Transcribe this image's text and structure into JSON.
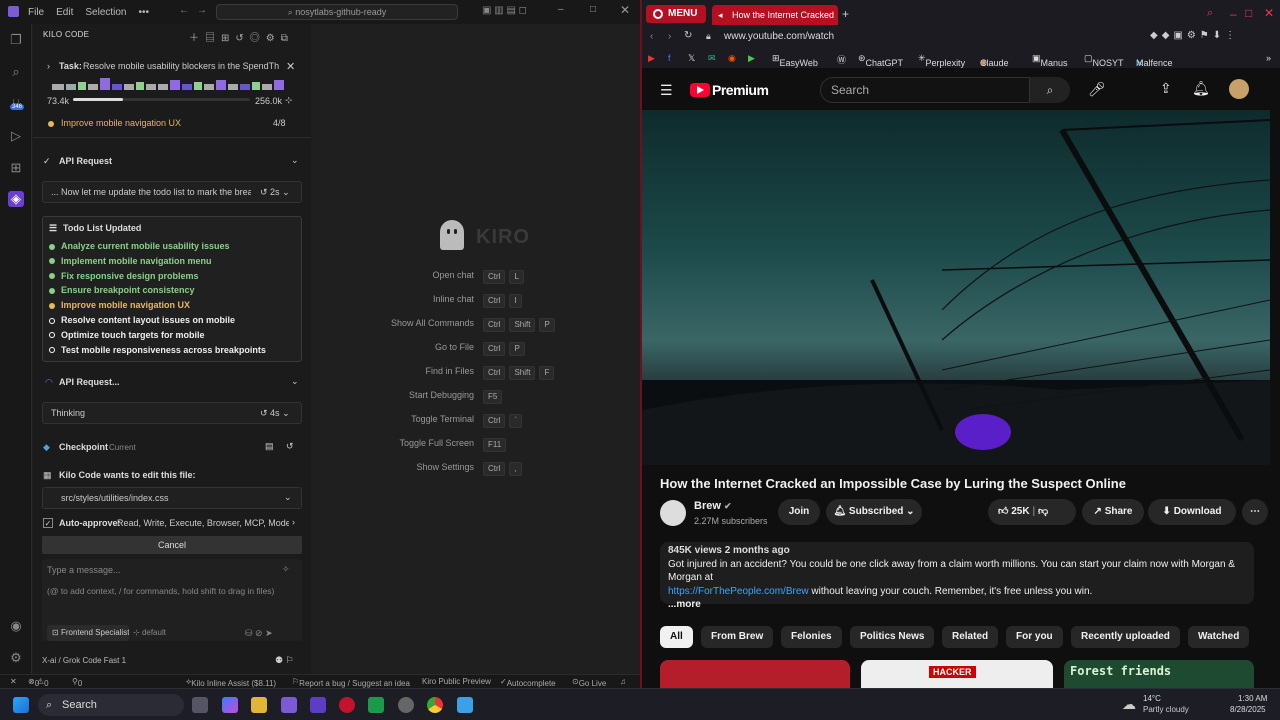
{
  "ide": {
    "menu": [
      "File",
      "Edit",
      "Selection"
    ],
    "search_text": "nosytlabs-github-ready",
    "activity_badge": "346",
    "panel_title": "KILO CODE",
    "task": {
      "prefix": "Task:",
      "text": "Resolve mobile usability blockers in the SpendTh...",
      "tokens_in": "73.4k",
      "tokens_max": "256.0k",
      "context_progress": 0.28
    },
    "current_todo": {
      "label": "Improve mobile navigation UX",
      "count": "4/8"
    },
    "api_request": {
      "label": "API Request",
      "detail": "... Now let me update the todo list to mark the brea...",
      "time": "2s"
    },
    "todo_list": {
      "title": "Todo List Updated",
      "items": [
        {
          "label": "Analyze current mobile usability issues",
          "state": "done",
          "color": "#89d185"
        },
        {
          "label": "Implement mobile navigation menu",
          "state": "done",
          "color": "#89d185"
        },
        {
          "label": "Fix responsive design problems",
          "state": "done",
          "color": "#89d185"
        },
        {
          "label": "Ensure breakpoint consistency",
          "state": "done",
          "color": "#89d185"
        },
        {
          "label": "Improve mobile navigation UX",
          "state": "in-progress",
          "color": "#e8b85a"
        },
        {
          "label": "Resolve content layout issues on mobile",
          "state": "pending",
          "color": "#ffffff"
        },
        {
          "label": "Optimize touch targets for mobile",
          "state": "pending",
          "color": "#ffffff"
        },
        {
          "label": "Test mobile responsiveness across breakpoints",
          "state": "pending",
          "color": "#ffffff"
        }
      ]
    },
    "api_request2": {
      "label": "API Request...",
      "detail": "Thinking",
      "time": "4s"
    },
    "checkpoint": {
      "label": "Checkpoint",
      "status": "Current"
    },
    "edit_prompt": "Kilo Code wants to edit this file:",
    "file_path": "src/styles/utilities/index.css",
    "auto_approve": {
      "label": "Auto-approve:",
      "value": "Read, Write, Execute, Browser, MCP, Mode, ..."
    },
    "cancel_label": "Cancel",
    "message_placeholder": "Type a message...",
    "message_hint": "(@ to add context, / for commands, hold shift to drag in files)",
    "mode": "Frontend Specialist",
    "profile": "default",
    "model": "X-ai / Grok Code Fast 1",
    "editor_brand": "KIRO",
    "shortcuts": [
      {
        "label": "Open chat",
        "keys": [
          "Ctrl",
          "L"
        ]
      },
      {
        "label": "Inline chat",
        "keys": [
          "Ctrl",
          "I"
        ]
      },
      {
        "label": "Show All Commands",
        "keys": [
          "Ctrl",
          "Shift",
          "P"
        ]
      },
      {
        "label": "Go to File",
        "keys": [
          "Ctrl",
          "P"
        ]
      },
      {
        "label": "Find in Files",
        "keys": [
          "Ctrl",
          "Shift",
          "F"
        ]
      },
      {
        "label": "Start Debugging",
        "keys": [
          "F5"
        ]
      },
      {
        "label": "Toggle Terminal",
        "keys": [
          "Ctrl",
          "`"
        ]
      },
      {
        "label": "Toggle Full Screen",
        "keys": [
          "F11"
        ]
      },
      {
        "label": "Show Settings",
        "keys": [
          "Ctrl",
          ","
        ]
      }
    ],
    "status": {
      "errors": "0",
      "warnings": "0",
      "ports": "0",
      "inline_assist": "Kilo Inline Assist ($8.11)",
      "report": "Report a bug / Suggest an idea",
      "preview": "Kiro Public Preview",
      "autocomplete": "Autocomplete",
      "golive": "Go Live"
    }
  },
  "browser": {
    "menu_label": "MENU",
    "tab_title": "How the Internet Cracked",
    "url": "www.youtube.com/watch",
    "bookmarks": [
      "EasyWeb",
      "ChatGPT",
      "Perplexity",
      "Claude",
      "Manus",
      "NOSYT",
      "Malfence"
    ],
    "youtube": {
      "logo": "Premium",
      "search_placeholder": "Search",
      "video_title": "How the Internet Cracked an Impossible Case by Luring the Suspect Online",
      "channel": "Brew",
      "subscribers": "2.27M subscribers",
      "join": "Join",
      "subscribed": "Subscribed",
      "likes": "25K",
      "share": "Share",
      "download": "Download",
      "views_date": "845K views  2 months ago",
      "desc_line1": "Got injured in an accident? You could be one click away from a claim worth millions. You can start your claim now with Morgan & Morgan at",
      "desc_link": "https://ForThePeople.com/Brew",
      "desc_line2": "without leaving your couch. Remember, it's free unless you win.",
      "more": "...more",
      "chips": [
        "All",
        "From Brew",
        "Felonies",
        "Politics News",
        "Related",
        "For you",
        "Recently uploaded",
        "Watched"
      ],
      "thumb_labels": [
        "HACKER",
        "Forest friends"
      ]
    }
  },
  "taskbar": {
    "search": "Search",
    "weather_temp": "14°C",
    "weather_desc": "Partly cloudy",
    "time": "1:30 AM",
    "date": "8/28/2025"
  }
}
